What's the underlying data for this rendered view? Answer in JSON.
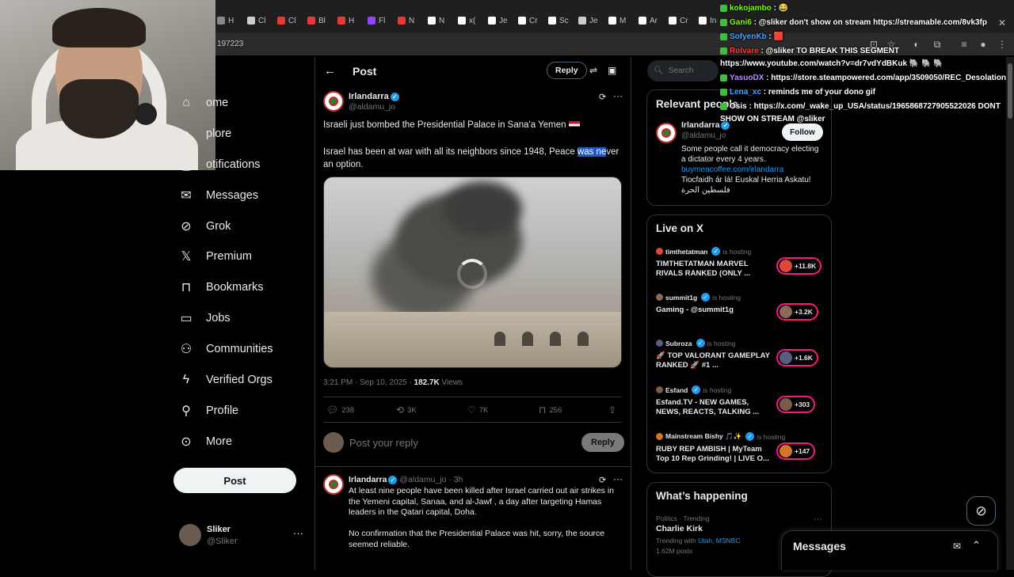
{
  "browser": {
    "tabs": [
      "H",
      "Cl",
      "Cl",
      "Bl",
      "H",
      "Fl",
      "N",
      "N",
      "x(",
      "Je",
      "Cr",
      "Sc",
      "Je",
      "M",
      "Ar",
      "Cr",
      "In"
    ],
    "url": "197223"
  },
  "nav": {
    "items": [
      {
        "label": "ome",
        "icon": "home-icon"
      },
      {
        "label": "plore",
        "icon": "search-icon"
      },
      {
        "label": "otifications",
        "icon": "bell-icon"
      },
      {
        "label": "Messages",
        "icon": "mail-icon"
      },
      {
        "label": "Grok",
        "icon": "grok-icon"
      },
      {
        "label": "Premium",
        "icon": "x-logo-icon"
      },
      {
        "label": "Bookmarks",
        "icon": "bookmark-icon"
      },
      {
        "label": "Jobs",
        "icon": "briefcase-icon"
      },
      {
        "label": "Communities",
        "icon": "people-icon"
      },
      {
        "label": "Verified Orgs",
        "icon": "lightning-icon"
      },
      {
        "label": "Profile",
        "icon": "person-icon"
      },
      {
        "label": "More",
        "icon": "more-circle-icon"
      }
    ],
    "post_label": "Post",
    "account": {
      "name": "Sliker",
      "handle": "@Sliker",
      "more": "···"
    }
  },
  "main": {
    "heading": "Post",
    "reply_label": "Reply",
    "tweet": {
      "name": "Irlandarra",
      "handle": "@aldamu_jo",
      "line1": "Israeli just bombed the Presidential Palace in Sana'a Yemen",
      "line2_before": "Israel has been at war with all its neighbors since 1948, Peace ",
      "line2_selected": "was ne",
      "line2_after": "ver an option.",
      "time": "3:21 PM · Sep 10, 2025 · ",
      "views_count": "182.7K",
      "views_label": " Views",
      "stats": {
        "replies": "238",
        "reposts": "3K",
        "likes": "7K",
        "bookmarks": "256"
      }
    },
    "reply_box": {
      "placeholder": "Post your reply",
      "button": "Reply"
    },
    "reply_tweet": {
      "name": "Irlandarra",
      "handle_time": "@aldamu_jo · 3h",
      "body1": "At least nine people have been killed after Israel carried out air strikes in the Yemeni capital, Sanaa, and al-Jawf , a day after targeting Hamas leaders in the Qatari capital, Doha.",
      "body2": "No confirmation that the Presidential Palace was hit, sorry, the source seemed reliable."
    }
  },
  "sidebar": {
    "search_placeholder": "Search",
    "relevant": {
      "title": "Relevant people",
      "name": "Irlandarra",
      "handle": "@aldamu_jo",
      "follow": "Follow",
      "bio1": "Some people call it democracy electing a dictator every 4 years.",
      "link": "buymeacoffee.com/irlandarra",
      "bio2": "Tiocfaidh ár lá! Euskal Herria Askatu!",
      "bio3": "فلسطين الحرة"
    },
    "live": {
      "title": "Live on X",
      "hosting": "is hosting",
      "rows": [
        {
          "host": "timthetatman",
          "title": "TIMTHETATMAN MARVEL RIVALS RANKED (ONLY ...",
          "count": "+11.8K",
          "color": "#e0463a"
        },
        {
          "host": "summit1g",
          "title": "Gaming - @summit1g",
          "count": "+3.2K",
          "color": "#8a6a55"
        },
        {
          "host": "Subroza",
          "title": "🚀 TOP VALORANT GAMEPLAY RANKED 🚀 #1 ...",
          "count": "+1.6K",
          "color": "#556080"
        },
        {
          "host": "Esfand",
          "title": "Esfand.TV - NEW GAMES, NEWS, REACTS, TALKING ...",
          "count": "+303",
          "color": "#7a5a48"
        },
        {
          "host": "Mainstream Bishy 🎵✨",
          "title": "RUBY REP AMBISH | MyTeam Top 10 Rep Grinding! | LIVE O...",
          "count": "+147",
          "color": "#d2762b"
        }
      ]
    },
    "happening": {
      "title": "What’s happening",
      "category": "Politics · Trending",
      "topic": "Charlie Kirk",
      "trending_prefix": "Trending with ",
      "trending_links": "Utah, MSNBC",
      "posts": "1.62M posts"
    }
  },
  "chat": [
    {
      "user": "kokojambo",
      "msg": " : 😂",
      "color": "#7cfc00"
    },
    {
      "user": "Gani6",
      "msg": " : @sliker don't show on stream https://streamable.com/8vk3fp",
      "color": "#7cfc00"
    },
    {
      "user": "SofyenKb",
      "msg": " : 🟥",
      "color": "#4aa3ff"
    },
    {
      "user": "Rolvare",
      "msg": " : @sliker TO BREAK THIS SEGMENT",
      "color": "#ff3b3b"
    },
    {
      "user": "",
      "msg": "https://www.youtube.com/watch?v=dr7vdYdBKuk 🐘 🐘 🐘",
      "color": "#ffffff"
    },
    {
      "user": "YasuoDX",
      "msg": " : https://store.steampowered.com/app/3509050/REC_Desolation/",
      "color": "#b98cff"
    },
    {
      "user": "Lena_xc",
      "msg": " : reminds me of your dono gif",
      "color": "#4aa3ff"
    },
    {
      "user": "Osis",
      "msg": " : https://x.com/_wake_up_USA/status/1965868727905522026 DONT",
      "color": "#ffffff"
    },
    {
      "user": "",
      "msg": "SHOW ON STREAM @sliker",
      "color": "#ffffff"
    }
  ],
  "messages_drawer": {
    "title": "Messages"
  }
}
